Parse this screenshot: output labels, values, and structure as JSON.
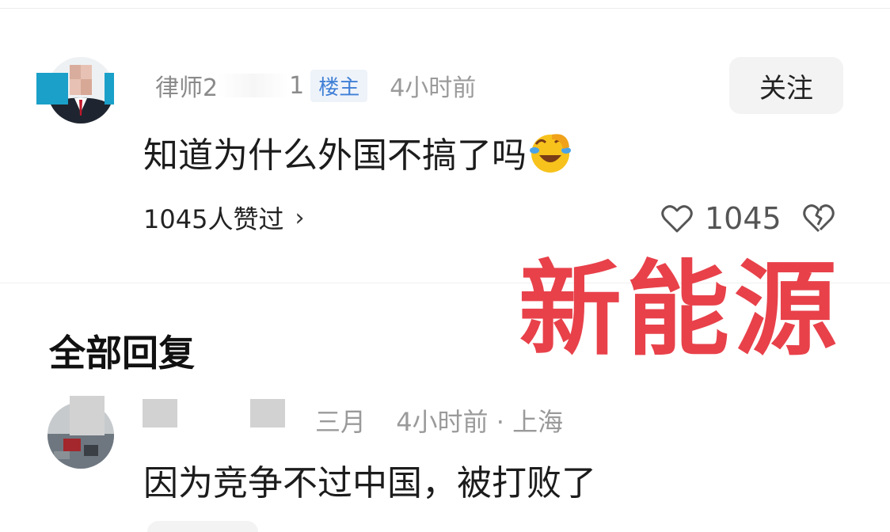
{
  "main_comment": {
    "user_prefix": "律师2",
    "user_fragment": "1",
    "badge": "楼主",
    "time": "4小时前",
    "follow_label": "关注",
    "text": "知道为什么外国不搞了吗",
    "emoji": "rolling-laugh-emoji",
    "likes_text": "1045人赞过",
    "like_count": "1045",
    "icons": {
      "like": "heart-icon",
      "dislike": "broken-heart-icon",
      "chevron": "chevron-right-icon"
    }
  },
  "overlay_text": "新能源",
  "replies": {
    "title": "全部回复",
    "items": [
      {
        "user_suffix": "三月",
        "time": "4小时前",
        "separator": "·",
        "location": "上海",
        "text": "因为竞争不过中国，被打败了"
      }
    ]
  },
  "colors": {
    "overlay_red": "#e8414a",
    "badge_blue": "#3f7fd6",
    "secondary_text": "#9a9a9a"
  }
}
